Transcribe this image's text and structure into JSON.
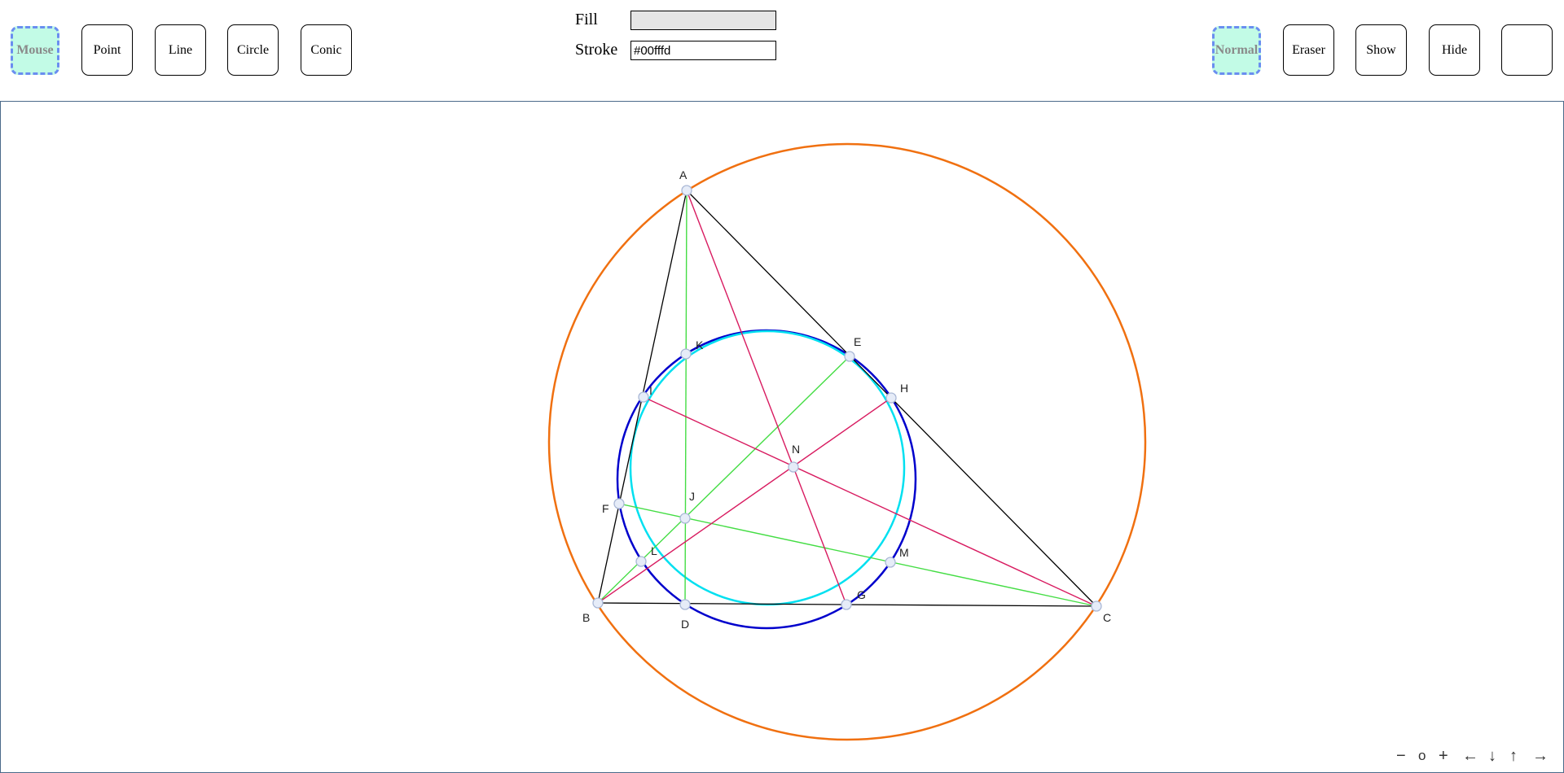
{
  "toolbar_left": {
    "mouse": "Mouse",
    "point": "Point",
    "line": "Line",
    "circle": "Circle",
    "conic": "Conic"
  },
  "style_panel": {
    "fill_label": "Fill",
    "fill_value": "",
    "stroke_label": "Stroke",
    "stroke_value": "#00fffd"
  },
  "toolbar_right": {
    "normal": "Normal",
    "eraser": "Eraser",
    "show": "Show",
    "hide": "Hide",
    "extra": ""
  },
  "active_color": "#c2fbe6",
  "active_border_color": "#6a8ef0",
  "canvas": {
    "points": {
      "A": "A",
      "B": "B",
      "C": "C",
      "D": "D",
      "E": "E",
      "F": "F",
      "G": "G",
      "H": "H",
      "I": "I",
      "J": "J",
      "K": "K",
      "L": "L",
      "M": "M",
      "N": "N"
    },
    "colors": {
      "circumcircle": "#f07010",
      "nine_point_circle": "#0000cc",
      "stroke_circle": "#00e0f0",
      "triangle": "#000000",
      "green_lines": "#44dd44",
      "pink_lines": "#d81b60"
    }
  },
  "zoom_controls": {
    "zoom_out": "−",
    "reset": "o",
    "zoom_in": "+",
    "pan_left": "←",
    "pan_down": "↓",
    "pan_up": "↑",
    "pan_right": "→"
  }
}
